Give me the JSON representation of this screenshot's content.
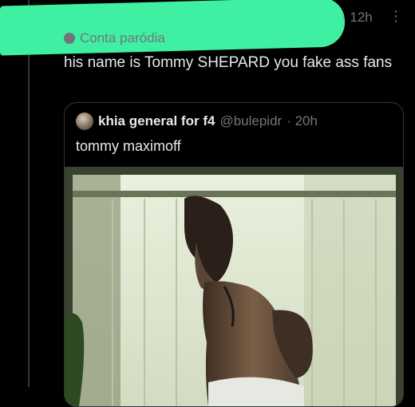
{
  "post": {
    "time": "· 12h",
    "more_icon": "more-icon",
    "account_label": "Conta paródia",
    "text": "his name is Tommy SHEPARD you fake ass fans"
  },
  "quote": {
    "display_name": "khia general for f4",
    "handle": "@bulepidr",
    "time": "· 20h",
    "text": "tommy maximoff"
  },
  "colors": {
    "background": "#000000",
    "text": "#e7e9ea",
    "muted": "#71767b",
    "border": "#333639",
    "redaction": "#3ff0a2"
  }
}
